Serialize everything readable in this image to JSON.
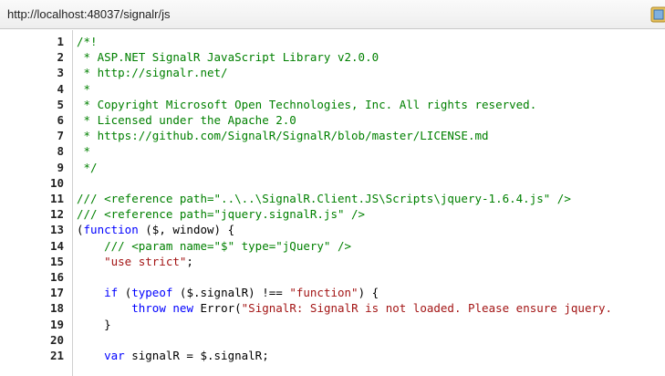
{
  "address_bar": {
    "url": "http://localhost:48037/signalr/js"
  },
  "icons": {
    "corner": "page-icon"
  },
  "colors": {
    "comment": "#008000",
    "string": "#a31515",
    "keyword": "#0000ff",
    "plain": "#000000"
  },
  "code_lines": [
    {
      "num": "1",
      "segments": [
        {
          "t": "/*!",
          "c": "com"
        }
      ]
    },
    {
      "num": "2",
      "segments": [
        {
          "t": " * ASP.NET SignalR JavaScript Library v2.0.0",
          "c": "com"
        }
      ]
    },
    {
      "num": "3",
      "segments": [
        {
          "t": " * http://signalr.net/",
          "c": "com"
        }
      ]
    },
    {
      "num": "4",
      "segments": [
        {
          "t": " *",
          "c": "com"
        }
      ]
    },
    {
      "num": "5",
      "segments": [
        {
          "t": " * Copyright Microsoft Open Technologies, Inc. All rights reserved.",
          "c": "com"
        }
      ]
    },
    {
      "num": "6",
      "segments": [
        {
          "t": " * Licensed under the Apache 2.0",
          "c": "com"
        }
      ]
    },
    {
      "num": "7",
      "segments": [
        {
          "t": " * https://github.com/SignalR/SignalR/blob/master/LICENSE.md",
          "c": "com"
        }
      ]
    },
    {
      "num": "8",
      "segments": [
        {
          "t": " *",
          "c": "com"
        }
      ]
    },
    {
      "num": "9",
      "segments": [
        {
          "t": " */",
          "c": "com"
        }
      ]
    },
    {
      "num": "10",
      "segments": []
    },
    {
      "num": "11",
      "segments": [
        {
          "t": "/// <reference path=\"..\\..\\SignalR.Client.JS\\Scripts\\jquery-1.6.4.js\" />",
          "c": "com"
        }
      ]
    },
    {
      "num": "12",
      "segments": [
        {
          "t": "/// <reference path=\"jquery.signalR.js\" />",
          "c": "com"
        }
      ]
    },
    {
      "num": "13",
      "segments": [
        {
          "t": "(",
          "c": "pl"
        },
        {
          "t": "function",
          "c": "kw"
        },
        {
          "t": " ($, window) {",
          "c": "pl"
        }
      ]
    },
    {
      "num": "14",
      "segments": [
        {
          "t": "    /// <param name=\"$\" type=\"jQuery\" />",
          "c": "com"
        }
      ]
    },
    {
      "num": "15",
      "segments": [
        {
          "t": "    \"use strict\"",
          "c": "str"
        },
        {
          "t": ";",
          "c": "pl"
        }
      ]
    },
    {
      "num": "16",
      "segments": []
    },
    {
      "num": "17",
      "segments": [
        {
          "t": "    ",
          "c": "pl"
        },
        {
          "t": "if",
          "c": "kw"
        },
        {
          "t": " (",
          "c": "pl"
        },
        {
          "t": "typeof",
          "c": "kw"
        },
        {
          "t": " ($.signalR) !== ",
          "c": "pl"
        },
        {
          "t": "\"function\"",
          "c": "str"
        },
        {
          "t": ") {",
          "c": "pl"
        }
      ]
    },
    {
      "num": "18",
      "segments": [
        {
          "t": "        ",
          "c": "pl"
        },
        {
          "t": "throw",
          "c": "kw"
        },
        {
          "t": " ",
          "c": "pl"
        },
        {
          "t": "new",
          "c": "kw"
        },
        {
          "t": " Error(",
          "c": "pl"
        },
        {
          "t": "\"SignalR: SignalR is not loaded. Please ensure jquery.",
          "c": "str"
        }
      ]
    },
    {
      "num": "19",
      "segments": [
        {
          "t": "    }",
          "c": "pl"
        }
      ]
    },
    {
      "num": "20",
      "segments": []
    },
    {
      "num": "21",
      "segments": [
        {
          "t": "    ",
          "c": "pl"
        },
        {
          "t": "var",
          "c": "kw"
        },
        {
          "t": " signalR = $.signalR;",
          "c": "pl"
        }
      ]
    }
  ]
}
